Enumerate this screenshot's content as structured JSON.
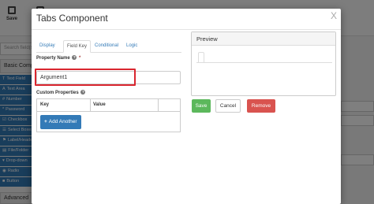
{
  "background": {
    "toolbar": {
      "save_label": "Save"
    },
    "sidebar": {
      "search_placeholder": "Search field(s)",
      "group_basic": "Basic Components",
      "group_advanced": "Advanced",
      "items": [
        {
          "icon": "T",
          "label": "Text Field"
        },
        {
          "icon": "A",
          "label": "Text Area"
        },
        {
          "icon": "#",
          "label": "Number"
        },
        {
          "icon": "*",
          "label": "Password"
        },
        {
          "icon": "☑",
          "label": "Checkbox"
        },
        {
          "icon": "☰",
          "label": "Select Boxes"
        },
        {
          "icon": "⚑",
          "label": "Label/Header"
        },
        {
          "icon": "▤",
          "label": "File/Folder"
        },
        {
          "icon": "▾",
          "label": "Drop-down"
        },
        {
          "icon": "◉",
          "label": "Radio"
        },
        {
          "icon": "■",
          "label": "Button"
        }
      ]
    }
  },
  "modal": {
    "title": "Tabs Component",
    "close_glyph": "X",
    "tabs": [
      {
        "label": "Display",
        "active": false
      },
      {
        "label": "Field Key",
        "active": true
      },
      {
        "label": "Conditional",
        "active": false
      },
      {
        "label": "Logic",
        "active": false
      }
    ],
    "property_name": {
      "label": "Property Name",
      "help_glyph": "?",
      "required_mark": "*",
      "value": "Argument1"
    },
    "custom_properties": {
      "label": "Custom Properties",
      "help_glyph": "?",
      "columns": [
        "Key",
        "Value"
      ],
      "add_button": {
        "icon": "+",
        "label": "Add Another"
      }
    },
    "preview": {
      "title": "Preview"
    },
    "actions": {
      "save": "Save",
      "cancel": "Cancel",
      "remove": "Remove"
    }
  },
  "colors": {
    "primary": "#337ab7",
    "success": "#5cb85c",
    "danger": "#d9534f",
    "highlight": "#d9262f"
  }
}
